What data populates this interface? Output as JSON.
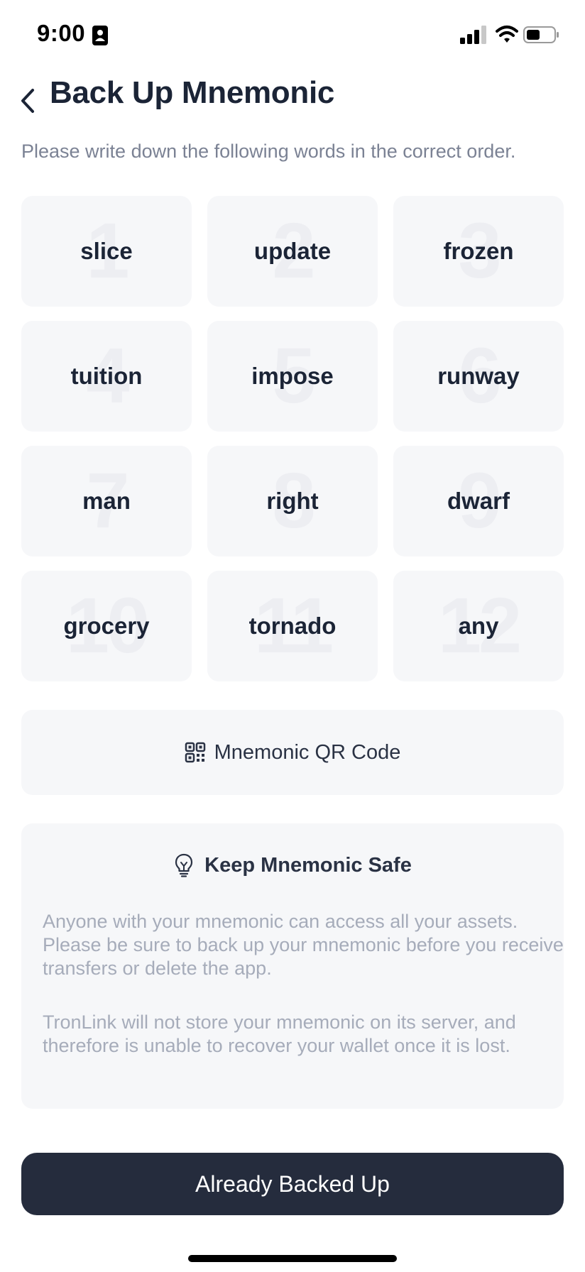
{
  "status_bar": {
    "time": "9:00",
    "icons": [
      "id-card-icon",
      "signal-icon",
      "wifi-icon",
      "battery-icon"
    ]
  },
  "header": {
    "back_icon": "chevron-left-icon",
    "title": "Back Up Mnemonic"
  },
  "instructions": "Please write down the following words in the correct order.",
  "mnemonic_words": [
    {
      "number": "1",
      "word": "slice"
    },
    {
      "number": "2",
      "word": "update"
    },
    {
      "number": "3",
      "word": "frozen"
    },
    {
      "number": "4",
      "word": "tuition"
    },
    {
      "number": "5",
      "word": "impose"
    },
    {
      "number": "6",
      "word": "runway"
    },
    {
      "number": "7",
      "word": "man"
    },
    {
      "number": "8",
      "word": "right"
    },
    {
      "number": "9",
      "word": "dwarf"
    },
    {
      "number": "10",
      "word": "grocery"
    },
    {
      "number": "11",
      "word": "tornado"
    },
    {
      "number": "12",
      "word": "any"
    }
  ],
  "qr_button": {
    "icon": "qr-code-icon",
    "label": "Mnemonic QR Code"
  },
  "safety_notice": {
    "icon": "lightbulb-icon",
    "title": "Keep Mnemonic Safe",
    "paragraphs": [
      "Anyone with your mnemonic can access all your assets. Please be sure to back up your mnemonic before you receive transfers or delete the app.",
      "TronLink will not store your mnemonic on its server, and therefore is unable to recover your wallet once it is lost."
    ]
  },
  "primary_button": {
    "label": "Already Backed Up"
  },
  "colors": {
    "title_text": "#1b2436",
    "secondary_text": "#7b8294",
    "muted_text": "#a6acba",
    "card_background": "#f6f7f9",
    "ghost_number": "#edeef2",
    "button_background": "#252c3d",
    "button_text": "#ffffff"
  }
}
